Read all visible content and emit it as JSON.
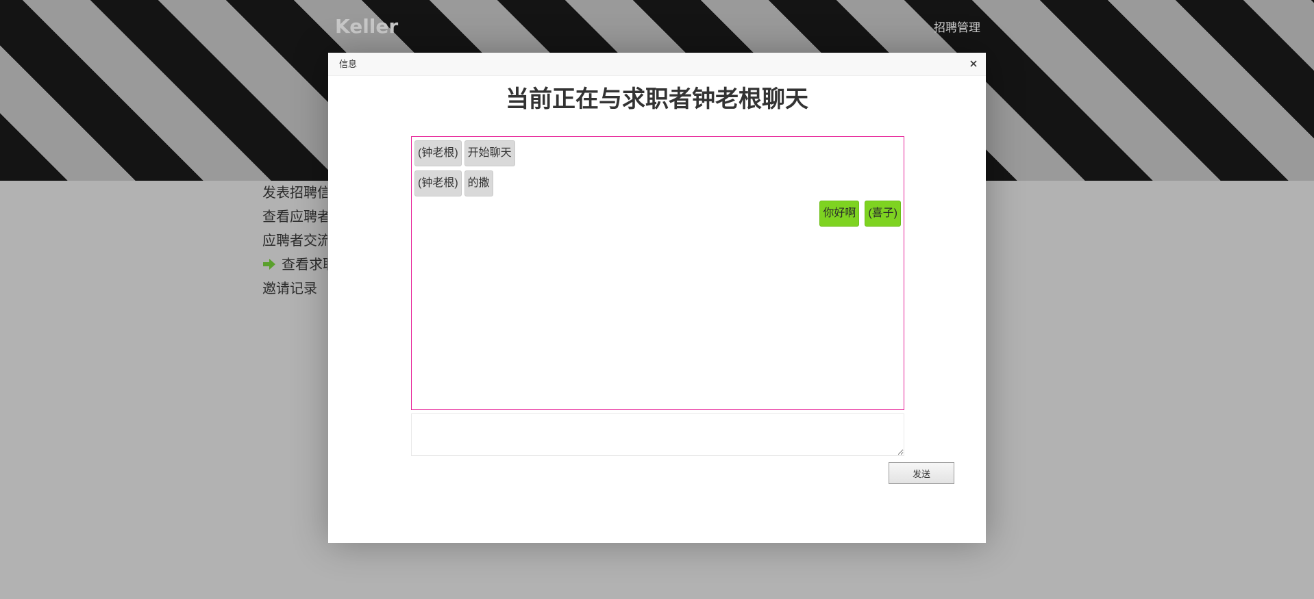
{
  "site": {
    "brand": "Keller",
    "nav_item": "招聘管理"
  },
  "side_menu": {
    "items": [
      {
        "label": "发表招聘信息"
      },
      {
        "label": "查看应聘者"
      },
      {
        "label": "应聘者交流"
      },
      {
        "label": "查看求职者",
        "icon": "green-arrow-icon"
      },
      {
        "label": "邀请记录"
      }
    ]
  },
  "modal": {
    "title": "信息",
    "heading": "当前正在与求职者钟老根聊天",
    "messages": [
      {
        "side": "left",
        "sender": "(钟老根)",
        "text": "开始聊天"
      },
      {
        "side": "left",
        "sender": "(钟老根)",
        "text": "的撒"
      },
      {
        "side": "right",
        "sender": "(喜子)",
        "text": "你好啊"
      }
    ],
    "input": {
      "value": "",
      "placeholder": ""
    },
    "send_label": "发送",
    "close_icon": "close-icon"
  },
  "colors": {
    "chat_border": "#e61e96",
    "self_bubble": "#7ed321",
    "other_bubble": "#d9d9d9",
    "overlay": "#b2b2b2"
  }
}
